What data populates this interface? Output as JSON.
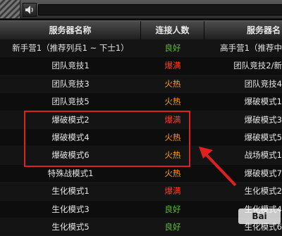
{
  "toolbar": {
    "volume_icon": "speaker-icon"
  },
  "table": {
    "columns": [
      "服务器名称",
      "连接人数",
      "服务器名"
    ],
    "rows": [
      {
        "name": "新手营1（推荐列兵1 ~ 下士1）",
        "status": "良好",
        "status_type": "good",
        "right": "高手营1（推荐中"
      },
      {
        "name": "团队竞技1",
        "status": "爆满",
        "status_type": "full",
        "right": "团队竞技2/新"
      },
      {
        "name": "团队竞技3",
        "status": "火热",
        "status_type": "hot",
        "right": "团队竞技4"
      },
      {
        "name": "团队竞技5",
        "status": "火热",
        "status_type": "hot",
        "right": "爆破模式1"
      },
      {
        "name": "爆破模式2",
        "status": "爆满",
        "status_type": "full",
        "right": "爆破模式3"
      },
      {
        "name": "爆破模式4",
        "status": "火热",
        "status_type": "hot",
        "right": "爆破模式5"
      },
      {
        "name": "爆破模式6",
        "status": "火热",
        "status_type": "hot",
        "right": "战场模式1"
      },
      {
        "name": "特殊战模式1",
        "status": "火热",
        "status_type": "hot",
        "right": "爆破模式7"
      },
      {
        "name": "生化模式1",
        "status": "爆满",
        "status_type": "full",
        "right": "生化模式2"
      },
      {
        "name": "生化模式3",
        "status": "良好",
        "status_type": "good",
        "right": "生化模式4"
      },
      {
        "name": "生化模式5",
        "status": "良好",
        "status_type": "good",
        "right": "生化模式6"
      }
    ]
  },
  "annotation": {
    "highlight_color": "#e02020",
    "arrow_color": "#e02020"
  },
  "watermark": {
    "text": "Bai"
  }
}
